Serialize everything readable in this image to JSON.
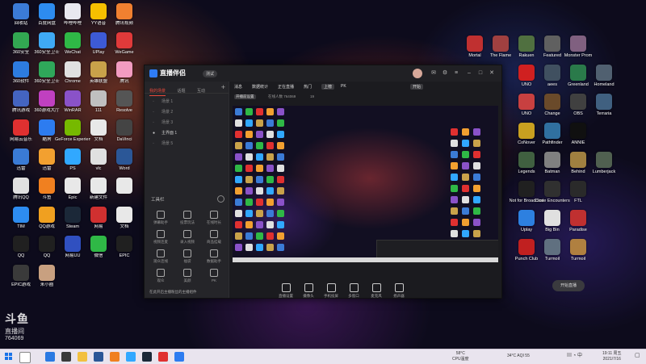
{
  "desktop": {
    "left_icons": [
      {
        "label": "回收站",
        "color": "#3b7bd6"
      },
      {
        "label": "百度网盘",
        "color": "#2d8cf0"
      },
      {
        "label": "哔哩哔哩",
        "color": "#e8e8f0"
      },
      {
        "label": "YY语音",
        "color": "#f5c000"
      },
      {
        "label": "腾讯视频",
        "color": "#f08030"
      },
      {
        "label": "360安全",
        "color": "#32a852"
      },
      {
        "label": "360安全卫士",
        "color": "#3fa9f5"
      },
      {
        "label": "WeChat",
        "color": "#2fb846"
      },
      {
        "label": "UPlay",
        "color": "#3d5ad6"
      },
      {
        "label": "WeGame",
        "color": "#e03a3a"
      },
      {
        "label": "360软件",
        "color": "#2d7ce0"
      },
      {
        "label": "360安全卫士",
        "color": "#2fa85a"
      },
      {
        "label": "Chrome",
        "color": "#e0e0e0"
      },
      {
        "label": "英雄联盟",
        "color": "#c9a24a"
      },
      {
        "label": "腾讯",
        "color": "#f29cc0"
      },
      {
        "label": "腾讯游戏",
        "color": "#4464c0"
      },
      {
        "label": "360游戏大厅",
        "color": "#c040c0"
      },
      {
        "label": "WinRAR",
        "color": "#8a52c8"
      },
      {
        "label": "111",
        "color": "#c0c0c0"
      },
      {
        "label": "Resolve",
        "color": "#555"
      },
      {
        "label": "网易云音乐",
        "color": "#e03030"
      },
      {
        "label": "酷狗",
        "color": "#2d7cf0"
      },
      {
        "label": "GeForce Experience",
        "color": "#76b900"
      },
      {
        "label": "文档",
        "color": "#e8e8e8"
      },
      {
        "label": "DaVinci",
        "color": "#444"
      },
      {
        "label": "迅雷",
        "color": "#3a7bd5"
      },
      {
        "label": "迅雷",
        "color": "#f2a030"
      },
      {
        "label": "PS",
        "color": "#31a8ff"
      },
      {
        "label": "vlc",
        "color": "#e0e0e0"
      },
      {
        "label": "Word",
        "color": "#2b5797"
      },
      {
        "label": "腾讯QQ",
        "color": "#e0e0e0"
      },
      {
        "label": "斗鱼",
        "color": "#f08020"
      },
      {
        "label": "Epic",
        "color": "#e8e8e8"
      },
      {
        "label": "新建文件",
        "color": "#e8e8e8"
      },
      {
        "label": "",
        "color": "#e8e8e8"
      },
      {
        "label": "TIM",
        "color": "#2d8cf0"
      },
      {
        "label": "QQ游戏",
        "color": "#f0a020"
      },
      {
        "label": "Steam",
        "color": "#1b2838"
      },
      {
        "label": "网易",
        "color": "#d03030"
      },
      {
        "label": "文档",
        "color": "#e8e8e8"
      },
      {
        "label": "QQ",
        "color": "#202020"
      },
      {
        "label": "QQ",
        "color": "#202020"
      },
      {
        "label": "网易UU",
        "color": "#3050c0"
      },
      {
        "label": "微信",
        "color": "#2fb846"
      },
      {
        "label": "EPIC",
        "color": "#202020"
      },
      {
        "label": "EPIC游戏",
        "color": "#3a3a3a"
      },
      {
        "label": "米小圈",
        "color": "#c8a080"
      }
    ],
    "right_icons": [
      {
        "label": "Mortal",
        "color": "#c03030"
      },
      {
        "label": "The Flame",
        "color": "#a04040"
      },
      {
        "label": "Rakuen",
        "color": "#507040"
      },
      {
        "label": "Featured",
        "color": "#606060"
      },
      {
        "label": "Monster Prom",
        "color": "#806080"
      },
      {
        "label": "UNO",
        "color": "#d02020"
      },
      {
        "label": "aees",
        "color": "#405060"
      },
      {
        "label": "Greenland",
        "color": "#2a7a4a"
      },
      {
        "label": "Homeland",
        "color": "#506070"
      },
      {
        "label": "UNO",
        "color": "#c84040"
      },
      {
        "label": "Change",
        "color": "#6a4a2a"
      },
      {
        "label": "OBS",
        "color": "#404040"
      },
      {
        "label": "Terraria",
        "color": "#406080"
      },
      {
        "label": "CoNover",
        "color": "#c8a020"
      },
      {
        "label": "Pathfinder",
        "color": "#3070a0"
      },
      {
        "label": "ANNIE",
        "color": "#101010"
      },
      {
        "label": "Legends",
        "color": "#406040"
      },
      {
        "label": "Batman",
        "color": "#808080"
      },
      {
        "label": "Behind",
        "color": "#a08040"
      },
      {
        "label": "Lumberjack",
        "color": "#506050"
      },
      {
        "label": "Not for Broadcast",
        "color": "#202020"
      },
      {
        "label": "Close Encounters",
        "color": "#303030"
      },
      {
        "label": "FTL",
        "color": "#2a2a2a"
      },
      {
        "label": "Uplay",
        "color": "#2d80e0"
      },
      {
        "label": "Big Bin",
        "color": "#e0e0e0"
      },
      {
        "label": "Paradise",
        "color": "#c03030"
      },
      {
        "label": "Punch Club",
        "color": "#c02020"
      },
      {
        "label": "Turmoil",
        "color": "#607080"
      },
      {
        "label": "Turmoil",
        "color": "#b08040"
      }
    ]
  },
  "app": {
    "logo": "直播伴侣",
    "version": "测试",
    "left_tabs": [
      "我的场景",
      "话题",
      "互动"
    ],
    "scenes": [
      "场景 1",
      "场景 2",
      "场景 3",
      "主界面 1",
      "场景 5"
    ],
    "tools_title": "工具栏",
    "tools": [
      "弹幕助手",
      "投票玩法",
      "在线时长",
      "视频连麦",
      "录入视频",
      "商品挂载",
      "观众连线",
      "福袋",
      "数据助手",
      "观众",
      "美颜",
      "PK"
    ],
    "notice": "在此开启主播粉丝的主播组件",
    "top_tabs": [
      "消息",
      "数据统计",
      "正在直播",
      "热门",
      "上榜",
      "PK",
      "开始"
    ],
    "sub_info": [
      "开播前设置",
      "在线人数 764069",
      "19"
    ],
    "controls": [
      "直播设置",
      "摄像头",
      "手机投屏",
      "多窗口",
      "麦克风",
      "扬声器"
    ],
    "start_label": "开始直播"
  },
  "overlay": {
    "line1": "斗鱼",
    "line2": "直播间",
    "line3": "764069"
  },
  "taskbar": {
    "temp": "58°C",
    "temp_label": "CPU温度",
    "weather": "34°C AQI 55",
    "time": "19:11 周五",
    "date": "2021/7/16"
  }
}
